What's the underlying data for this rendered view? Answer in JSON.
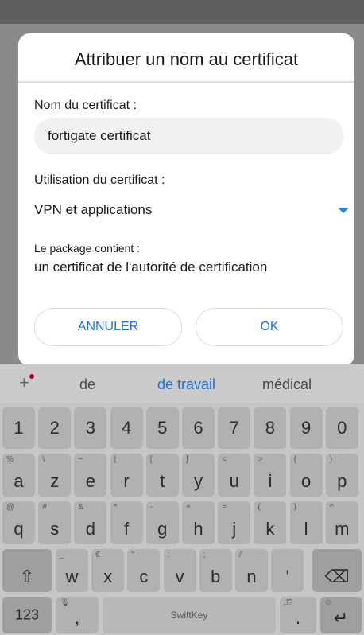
{
  "dialog": {
    "title": "Attribuer un nom au certificat",
    "name_label": "Nom du certificat :",
    "name_value": "fortigate certificat",
    "usage_label": "Utilisation du certificat :",
    "usage_value": "VPN et applications",
    "package_label": "Le package contient :",
    "package_value": "un certificat de l'autorité de certification",
    "cancel_label": "ANNULER",
    "ok_label": "OK"
  },
  "keyboard": {
    "suggestions": [
      "de",
      "de travail",
      "médical"
    ],
    "number_row": [
      "1",
      "2",
      "3",
      "4",
      "5",
      "6",
      "7",
      "8",
      "9",
      "0"
    ],
    "row1": [
      {
        "main": "a",
        "sec": "%"
      },
      {
        "main": "z",
        "sec": "\\"
      },
      {
        "main": "e",
        "sec": "~"
      },
      {
        "main": "r",
        "sec": "|"
      },
      {
        "main": "t",
        "sec": "["
      },
      {
        "main": "y",
        "sec": "]"
      },
      {
        "main": "u",
        "sec": "<"
      },
      {
        "main": "i",
        "sec": ">"
      },
      {
        "main": "o",
        "sec": "{"
      },
      {
        "main": "p",
        "sec": "}"
      }
    ],
    "row2": [
      {
        "main": "q",
        "sec": "@"
      },
      {
        "main": "s",
        "sec": "#"
      },
      {
        "main": "d",
        "sec": "&"
      },
      {
        "main": "f",
        "sec": "*"
      },
      {
        "main": "g",
        "sec": "-"
      },
      {
        "main": "h",
        "sec": "+"
      },
      {
        "main": "j",
        "sec": "="
      },
      {
        "main": "k",
        "sec": "("
      },
      {
        "main": "l",
        "sec": ")"
      },
      {
        "main": "m",
        "sec": "^"
      }
    ],
    "row3": [
      {
        "main": "w",
        "sec": "_"
      },
      {
        "main": "x",
        "sec": "€"
      },
      {
        "main": "c",
        "sec": "\""
      },
      {
        "main": "v",
        "sec": ":"
      },
      {
        "main": "b",
        "sec": ";"
      },
      {
        "main": "n",
        "sec": "/"
      },
      {
        "main": "'",
        "sec": ""
      }
    ],
    "shift_icon": "⇧",
    "backspace_icon": "⌫",
    "symbols_label": "123",
    "comma_label": ",",
    "mic_icon": "🎙",
    "space_label": "SwiftKey",
    "period_label": ".",
    "period_sec": ",!?",
    "enter_icon": "↵",
    "enter_sec": "☺"
  }
}
